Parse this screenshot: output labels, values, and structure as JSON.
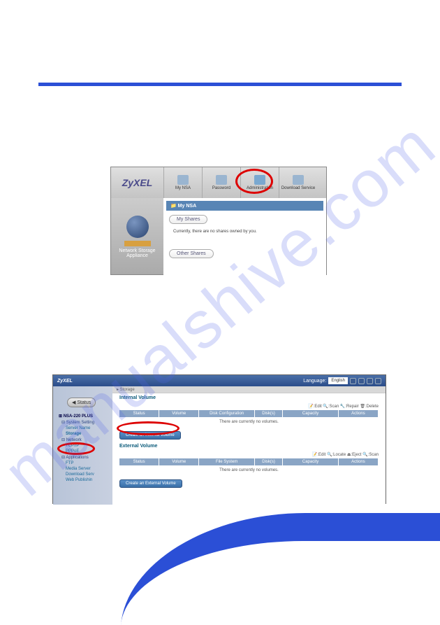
{
  "watermark": "manualshive.com",
  "fig1": {
    "logo": "ZyXEL",
    "tabs": [
      "My NSA",
      "Password",
      "Administration",
      "Download Service"
    ],
    "left_label": "Network Storage Appliance",
    "panel_header": "My NSA",
    "my_shares": "My Shares",
    "empty_text": "Currently, there are no shares owned by you.",
    "other_shares": "Other Shares"
  },
  "fig2": {
    "logo": "ZyXEL",
    "lang_label": "Language:",
    "lang_value": "English",
    "status_btn": "Status",
    "tree": {
      "root": "NSA-220 PLUS",
      "system": "System Setting",
      "server": "Server Name",
      "storage": "Storage",
      "network": "Network",
      "tcpip": "TCP/IP",
      "pppoe": "PPPoE",
      "apps": "Applications",
      "ftp": "FTP",
      "media": "Media Server",
      "download": "Download Serv",
      "web": "Web Publishin"
    },
    "breadcrumb": "▸ Storage",
    "internal_title": "Internal Volume",
    "internal_actions": "📝:Edit 🔍:Scan 🔧:Repair 🗑:Delete",
    "internal_headers": [
      "Status",
      "Volume",
      "Disk Configuration",
      "Disk(s)",
      "Capacity",
      "Actions"
    ],
    "internal_empty": "There are currently no volumes.",
    "create_internal": "Create an Internal Volume",
    "external_title": "External Volume",
    "external_actions": "📝:Edit 🔍:Locate ⏏:Eject 🔍:Scan",
    "external_headers": [
      "Status",
      "Volume",
      "File System",
      "Disk(s)",
      "Capacity",
      "Actions"
    ],
    "external_empty": "There are currently no volumes.",
    "create_external": "Create an External Volume"
  }
}
